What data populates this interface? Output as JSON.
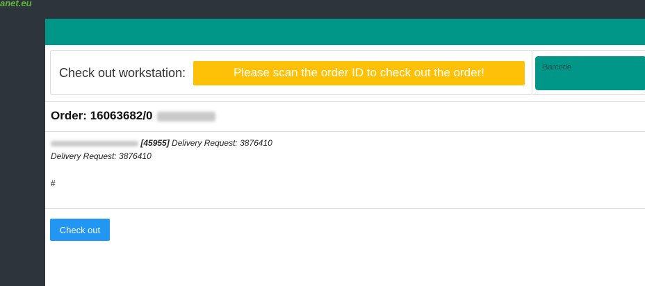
{
  "app": {
    "logo_text": "anet.eu"
  },
  "workstation": {
    "label": "Check out workstation:",
    "scan_message": "Please scan the order ID to check out the order!",
    "barcode_placeholder": "Barcode"
  },
  "order": {
    "title_prefix": "Order: 16063682/0",
    "line1_id": "[45955]",
    "line1_request": " Delivery Request: 3876410",
    "line2": "Delivery Request: 3876410",
    "hash": "#"
  },
  "actions": {
    "checkout_label": "Check out"
  },
  "colors": {
    "topbar": "#2e343c",
    "teal": "#009688",
    "warning": "#ffc107",
    "primary": "#2196f3"
  }
}
